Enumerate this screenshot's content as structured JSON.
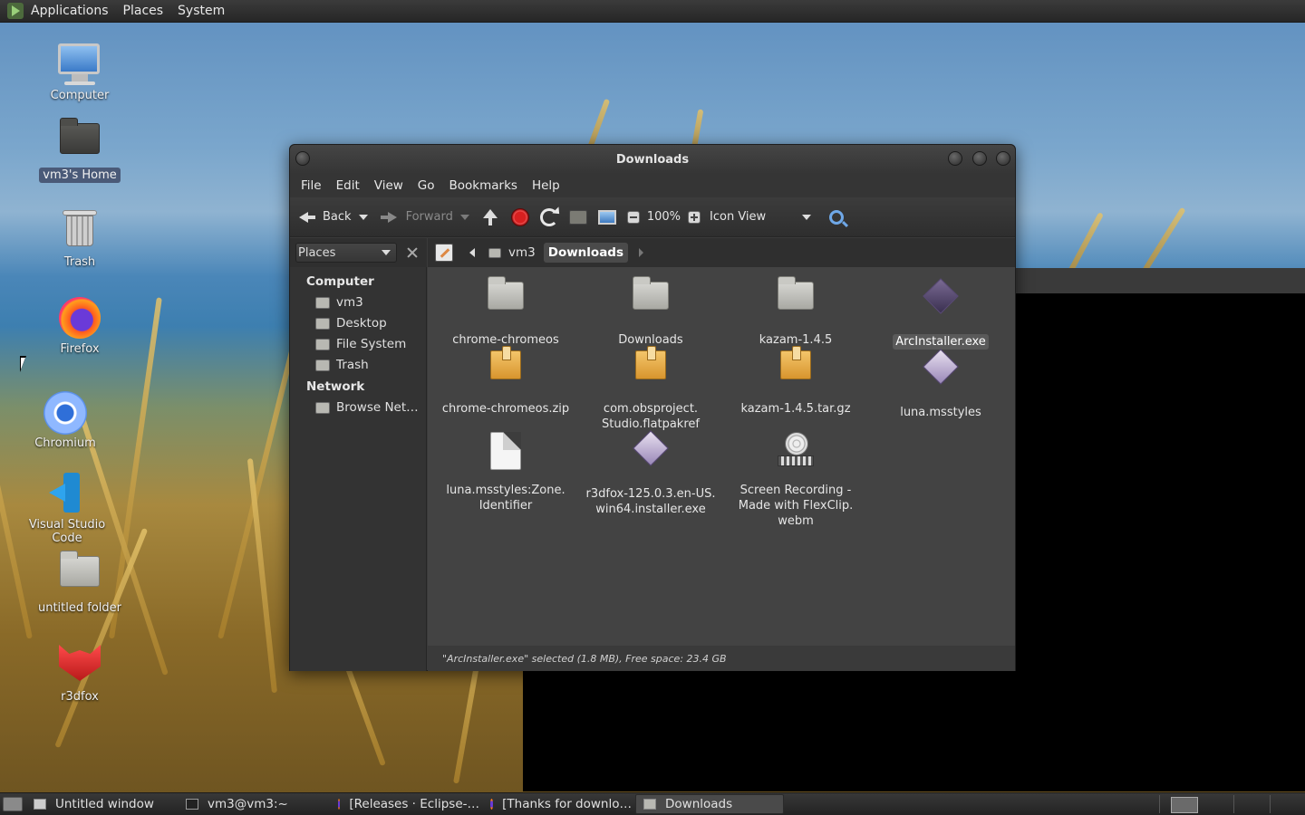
{
  "top_panel": {
    "menus": [
      "Applications",
      "Places",
      "System"
    ]
  },
  "desktop": {
    "icons": [
      {
        "label": "Computer",
        "icon": "computer-icon"
      },
      {
        "label": "vm3's Home",
        "icon": "home-folder-icon",
        "selected": true
      },
      {
        "label": "Trash",
        "icon": "trash-icon"
      },
      {
        "label": "Firefox",
        "icon": "firefox-icon"
      },
      {
        "label": "Chromium",
        "icon": "chromium-icon"
      },
      {
        "label": "Visual Studio Code",
        "icon": "vscode-icon"
      },
      {
        "label": "untitled folder",
        "icon": "folder-icon"
      },
      {
        "label": "r3dfox",
        "icon": "r3dfox-icon"
      }
    ]
  },
  "window": {
    "title": "Downloads",
    "menu": [
      "File",
      "Edit",
      "View",
      "Go",
      "Bookmarks",
      "Help"
    ],
    "toolbar": {
      "back": "Back",
      "forward": "Forward",
      "zoom": "100%",
      "view_mode": "Icon View"
    },
    "sidebar": {
      "selector": "Places",
      "groups": [
        {
          "title": "Computer",
          "items": [
            "vm3",
            "Desktop",
            "File System",
            "Trash"
          ]
        },
        {
          "title": "Network",
          "items": [
            "Browse Net…"
          ]
        }
      ]
    },
    "path": [
      "vm3",
      "Downloads"
    ],
    "files": [
      {
        "name": "chrome-chromeos",
        "type": "folder"
      },
      {
        "name": "Downloads",
        "type": "folder"
      },
      {
        "name": "kazam-1.4.5",
        "type": "folder"
      },
      {
        "name": "ArcInstaller.exe",
        "type": "exe",
        "selected": true
      },
      {
        "name": "chrome-chromeos.zip",
        "type": "archive"
      },
      {
        "name": "com.obsproject.\nStudio.flatpakref",
        "type": "archive"
      },
      {
        "name": "kazam-1.4.5.tar.gz",
        "type": "archive"
      },
      {
        "name": "luna.msstyles",
        "type": "exe"
      },
      {
        "name": "luna.msstyles:Zone.\nIdentifier",
        "type": "document"
      },
      {
        "name": "r3dfox-125.0.3.en-US.\nwin64.installer.exe",
        "type": "exe"
      },
      {
        "name": "Screen Recording -\nMade with FlexClip.\nwebm",
        "type": "video"
      }
    ],
    "status": "\"ArcInstaller.exe\" selected (1.8 MB), Free space: 23.4 GB"
  },
  "taskbar": {
    "tasks": [
      {
        "label": "Untitled window",
        "icon": "window-icon"
      },
      {
        "label": "vm3@vm3:~",
        "icon": "terminal-icon"
      },
      {
        "label": "[Releases · Eclipse-…",
        "icon": "firefox-icon"
      },
      {
        "label": "[Thanks for downlo…",
        "icon": "firefox-icon"
      },
      {
        "label": "Downloads",
        "icon": "folder-icon",
        "active": true
      }
    ]
  }
}
